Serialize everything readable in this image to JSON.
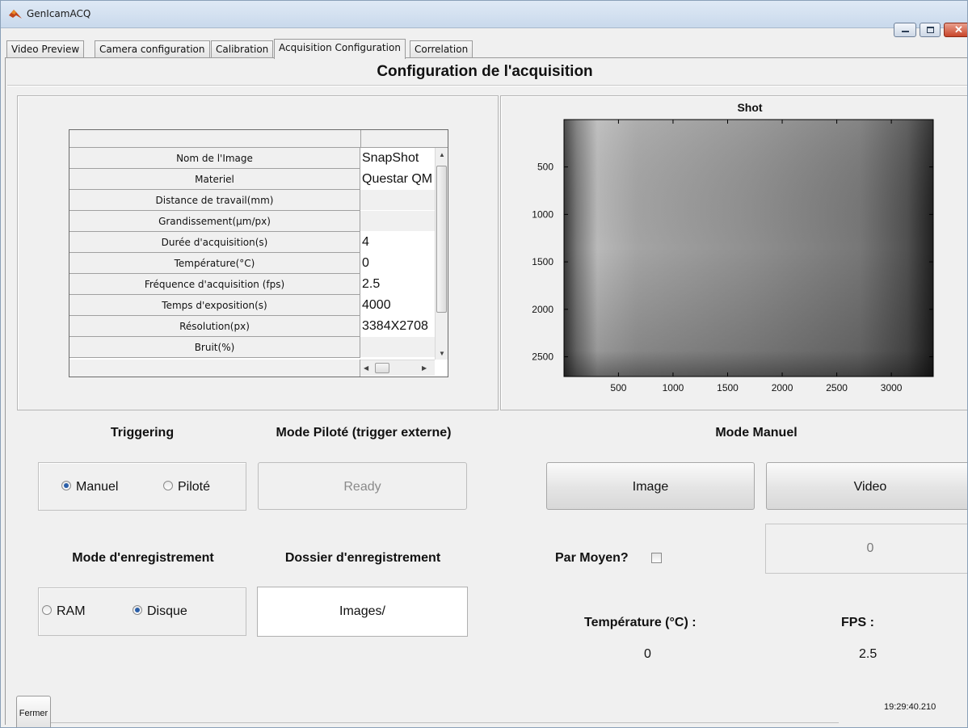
{
  "window": {
    "title": "GenIcamACQ"
  },
  "tabs": [
    {
      "label": "Video Preview",
      "active": false
    },
    {
      "label": "Camera configuration",
      "active": false
    },
    {
      "label": "Calibration",
      "active": false
    },
    {
      "label": "Acquisition Configuration",
      "active": true
    },
    {
      "label": "Correlation",
      "active": false
    }
  ],
  "page": {
    "title": "Configuration de l'acquisition"
  },
  "params_table": {
    "rows": [
      {
        "label": "Nom de l'Image",
        "value": "SnapShot"
      },
      {
        "label": "Materiel",
        "value": "Questar QM"
      },
      {
        "label": "Distance de travail(mm)",
        "value": ""
      },
      {
        "label": "Grandissement(µm/px)",
        "value": ""
      },
      {
        "label": "Durée d'acquisition(s)",
        "value": "4"
      },
      {
        "label": "Température(°C)",
        "value": "0"
      },
      {
        "label": "Fréquence d'acquisition (fps)",
        "value": "2.5"
      },
      {
        "label": "Temps d'exposition(s)",
        "value": "4000"
      },
      {
        "label": "Résolution(px)",
        "value": "3384X2708"
      },
      {
        "label": "Bruit(%)",
        "value": ""
      }
    ]
  },
  "chart_data": {
    "type": "heatmap",
    "title": "Shot",
    "xlabel": "",
    "ylabel": "",
    "x_ticks": [
      500,
      1000,
      1500,
      2000,
      2500,
      3000
    ],
    "y_ticks": [
      500,
      1000,
      1500,
      2000,
      2500
    ],
    "xlim": [
      1,
      3384
    ],
    "ylim": [
      1,
      2708
    ],
    "colormap": "gray",
    "description_values": {
      "left_edge": "dark",
      "left_band_x": 350,
      "right_edge": "dark",
      "center": "mid-gray"
    }
  },
  "triggering": {
    "title": "Triggering",
    "options": [
      {
        "label": "Manuel",
        "selected": true
      },
      {
        "label": "Piloté",
        "selected": false
      }
    ]
  },
  "mode_pilote": {
    "title": "Mode Piloté (trigger externe)",
    "button_label": "Ready"
  },
  "mode_manuel": {
    "title": "Mode Manuel",
    "image_button": "Image",
    "video_button": "Video",
    "count_value": "0",
    "par_moyen_label": "Par Moyen?",
    "par_moyen_checked": false
  },
  "enregistrement": {
    "title": "Mode d'enregistrement",
    "options": [
      {
        "label": "RAM",
        "selected": false
      },
      {
        "label": "Disque",
        "selected": true
      }
    ]
  },
  "dossier": {
    "title": "Dossier d'enregistrement",
    "value": "Images/"
  },
  "status": {
    "temperature_label": "Température (°C) :",
    "temperature_value": "0",
    "fps_label": "FPS :",
    "fps_value": "2.5"
  },
  "footer": {
    "close_button": "Fermer",
    "clock": "19:29:40.210"
  }
}
